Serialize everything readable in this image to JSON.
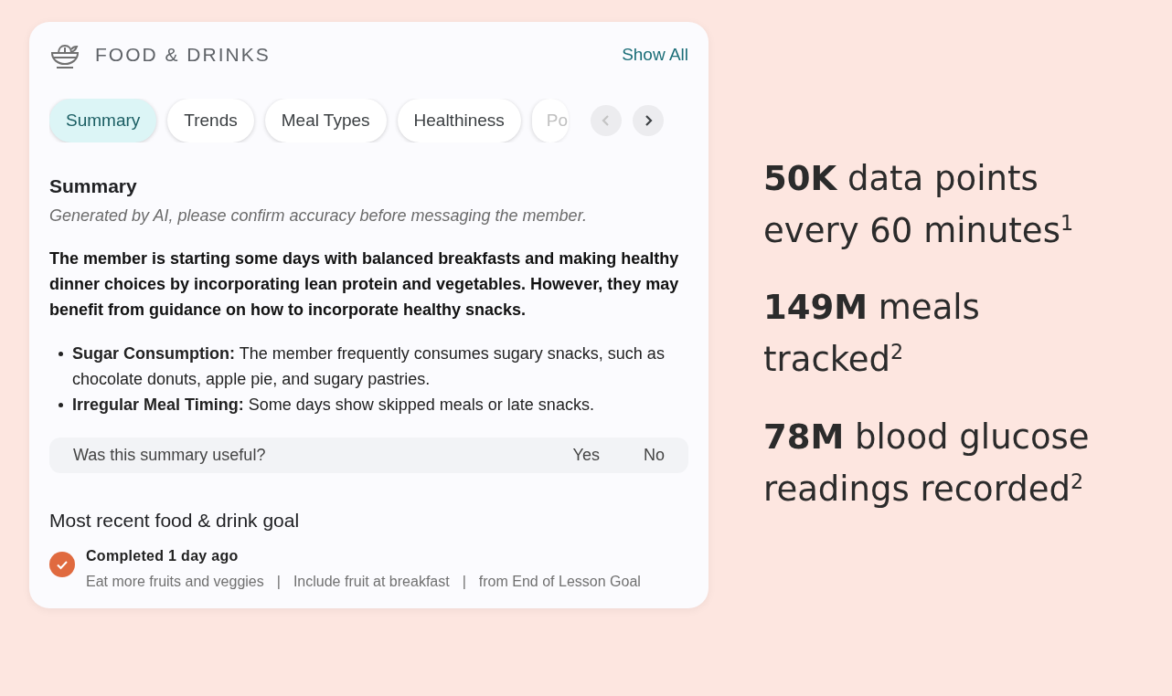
{
  "card": {
    "title": "FOOD & DRINKS",
    "show_all": "Show All",
    "tabs": [
      {
        "label": "Summary",
        "selected": true
      },
      {
        "label": "Trends",
        "selected": false
      },
      {
        "label": "Meal Types",
        "selected": false
      },
      {
        "label": "Healthiness",
        "selected": false
      },
      {
        "label": "Po",
        "selected": false
      }
    ],
    "prev_disabled": true,
    "next_disabled": false,
    "summary": {
      "heading": "Summary",
      "disclaimer": "Generated by AI, please confirm accuracy before messaging the member.",
      "text": "The member is starting some days with balanced breakfasts and making healthy dinner choices by incorporating lean protein and vegetables. However, they may benefit from guidance on how to incorporate healthy snacks.",
      "bullets": [
        "**Sugar Consumption:** The member frequently consumes sugary snacks, such as chocolate donuts, apple pie, and sugary pastries.",
        "**Irregular Meal Timing:** Some days show skipped meals or late snacks."
      ]
    },
    "feedback": {
      "question": "Was this summary useful?",
      "yes": "Yes",
      "no": "No"
    },
    "goal": {
      "heading": "Most recent food & drink goal",
      "completed": true,
      "status": "Completed 1 day ago",
      "details": [
        "Eat more fruits and veggies",
        "Include fruit at breakfast",
        "from End of Lesson Goal"
      ],
      "separator": "|"
    }
  },
  "stats": [
    {
      "lines": [
        "**50K** data points",
        "every 60 minutes$^{1}$"
      ]
    },
    {
      "lines": [
        "**149M** meals",
        "tracked$^{2}$"
      ]
    },
    {
      "lines": [
        "**78M** blood glucose",
        "readings recorded$^{2}$"
      ]
    }
  ]
}
